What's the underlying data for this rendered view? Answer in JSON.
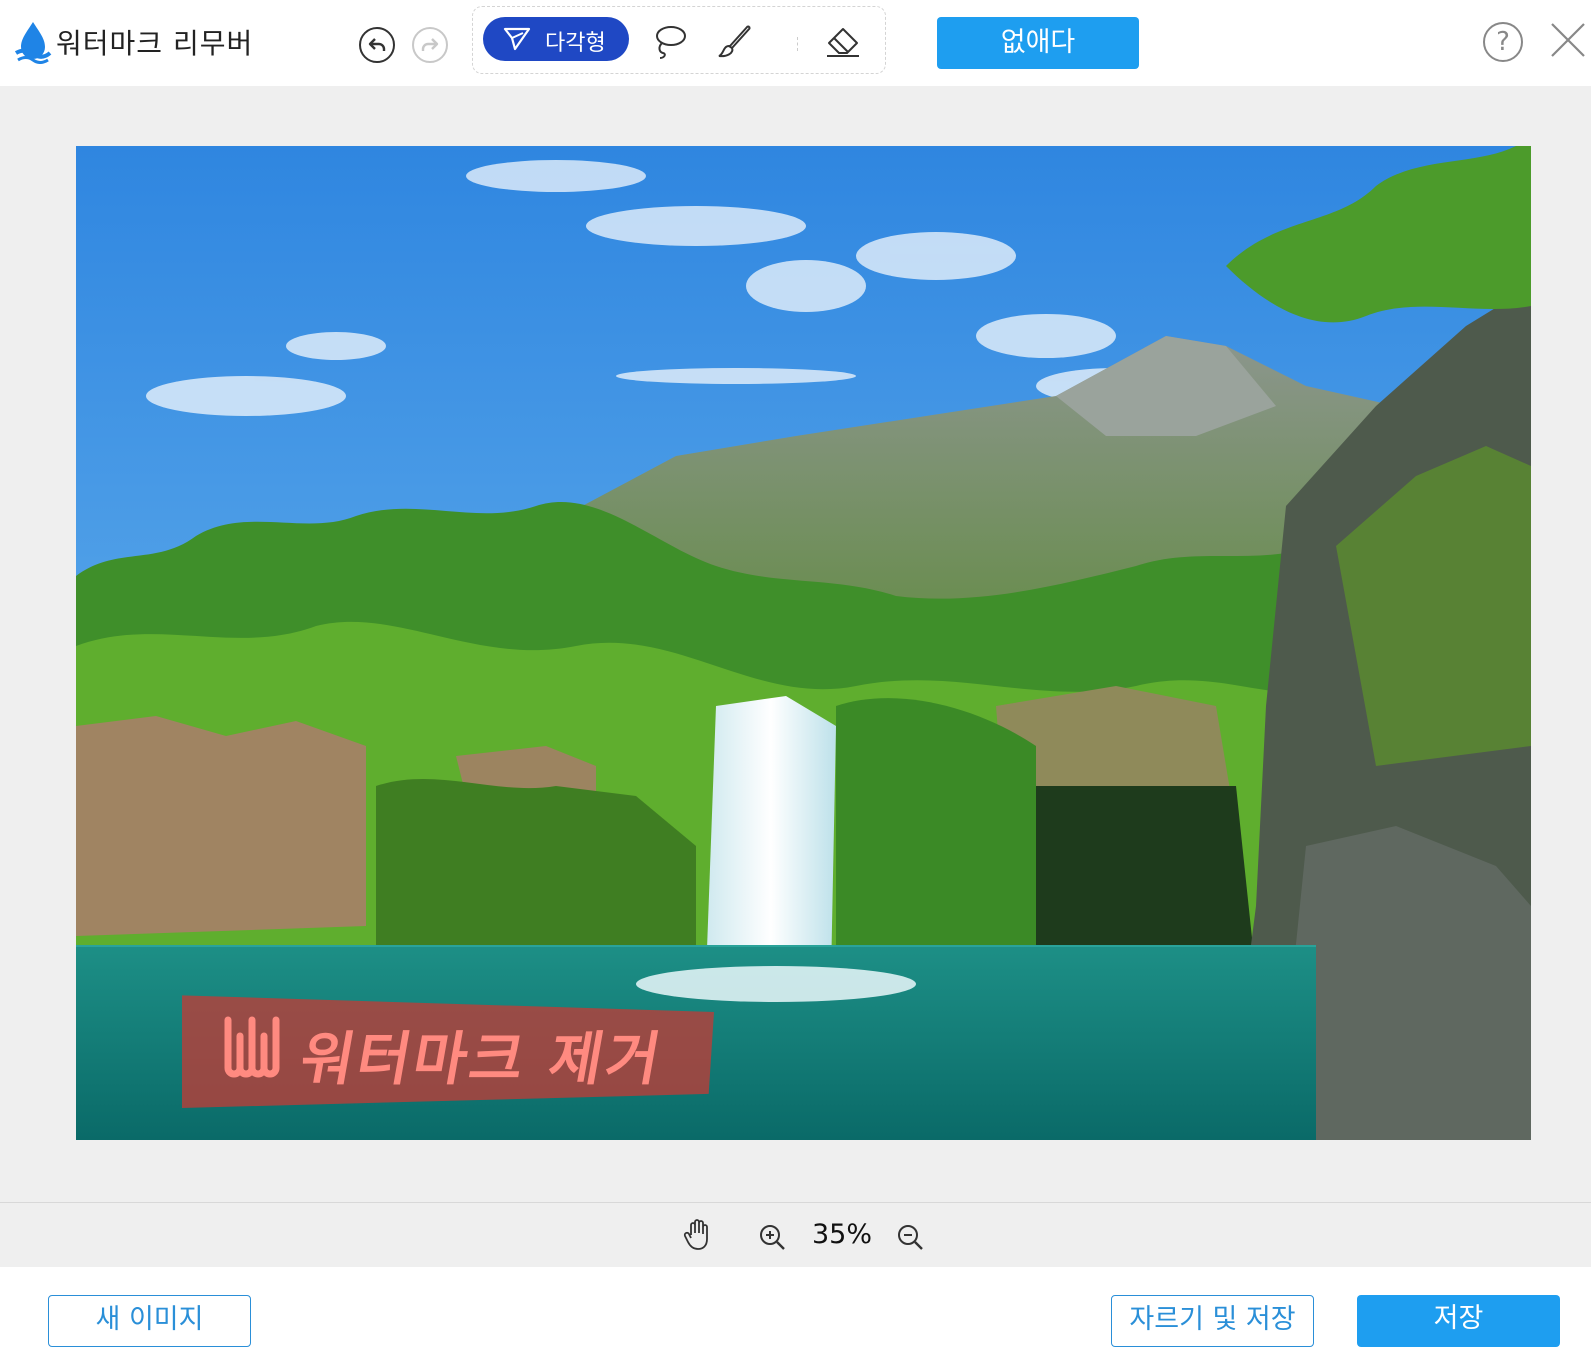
{
  "app": {
    "title": "워터마크 리무버"
  },
  "toolbar": {
    "polygon_label": "다각형",
    "icons": [
      "undo-icon",
      "redo-icon",
      "polygon-icon",
      "lasso-icon",
      "brush-icon",
      "eraser-icon"
    ],
    "remove_label": "없애다",
    "help_label": "?"
  },
  "image": {
    "watermark_text": "워터마크 제거",
    "description_icon": "waterfall-landscape"
  },
  "zoom": {
    "value": "35%"
  },
  "footer": {
    "new_image_label": "새 이미지",
    "crop_save_label": "자르기 및 저장",
    "save_label": "저장"
  },
  "colors": {
    "accent": "#1e9ef0",
    "active_tool": "#1f48c4",
    "workspace_bg": "#efefef",
    "watermark_band": "#be3c37",
    "watermark_text": "#ff8a80"
  }
}
